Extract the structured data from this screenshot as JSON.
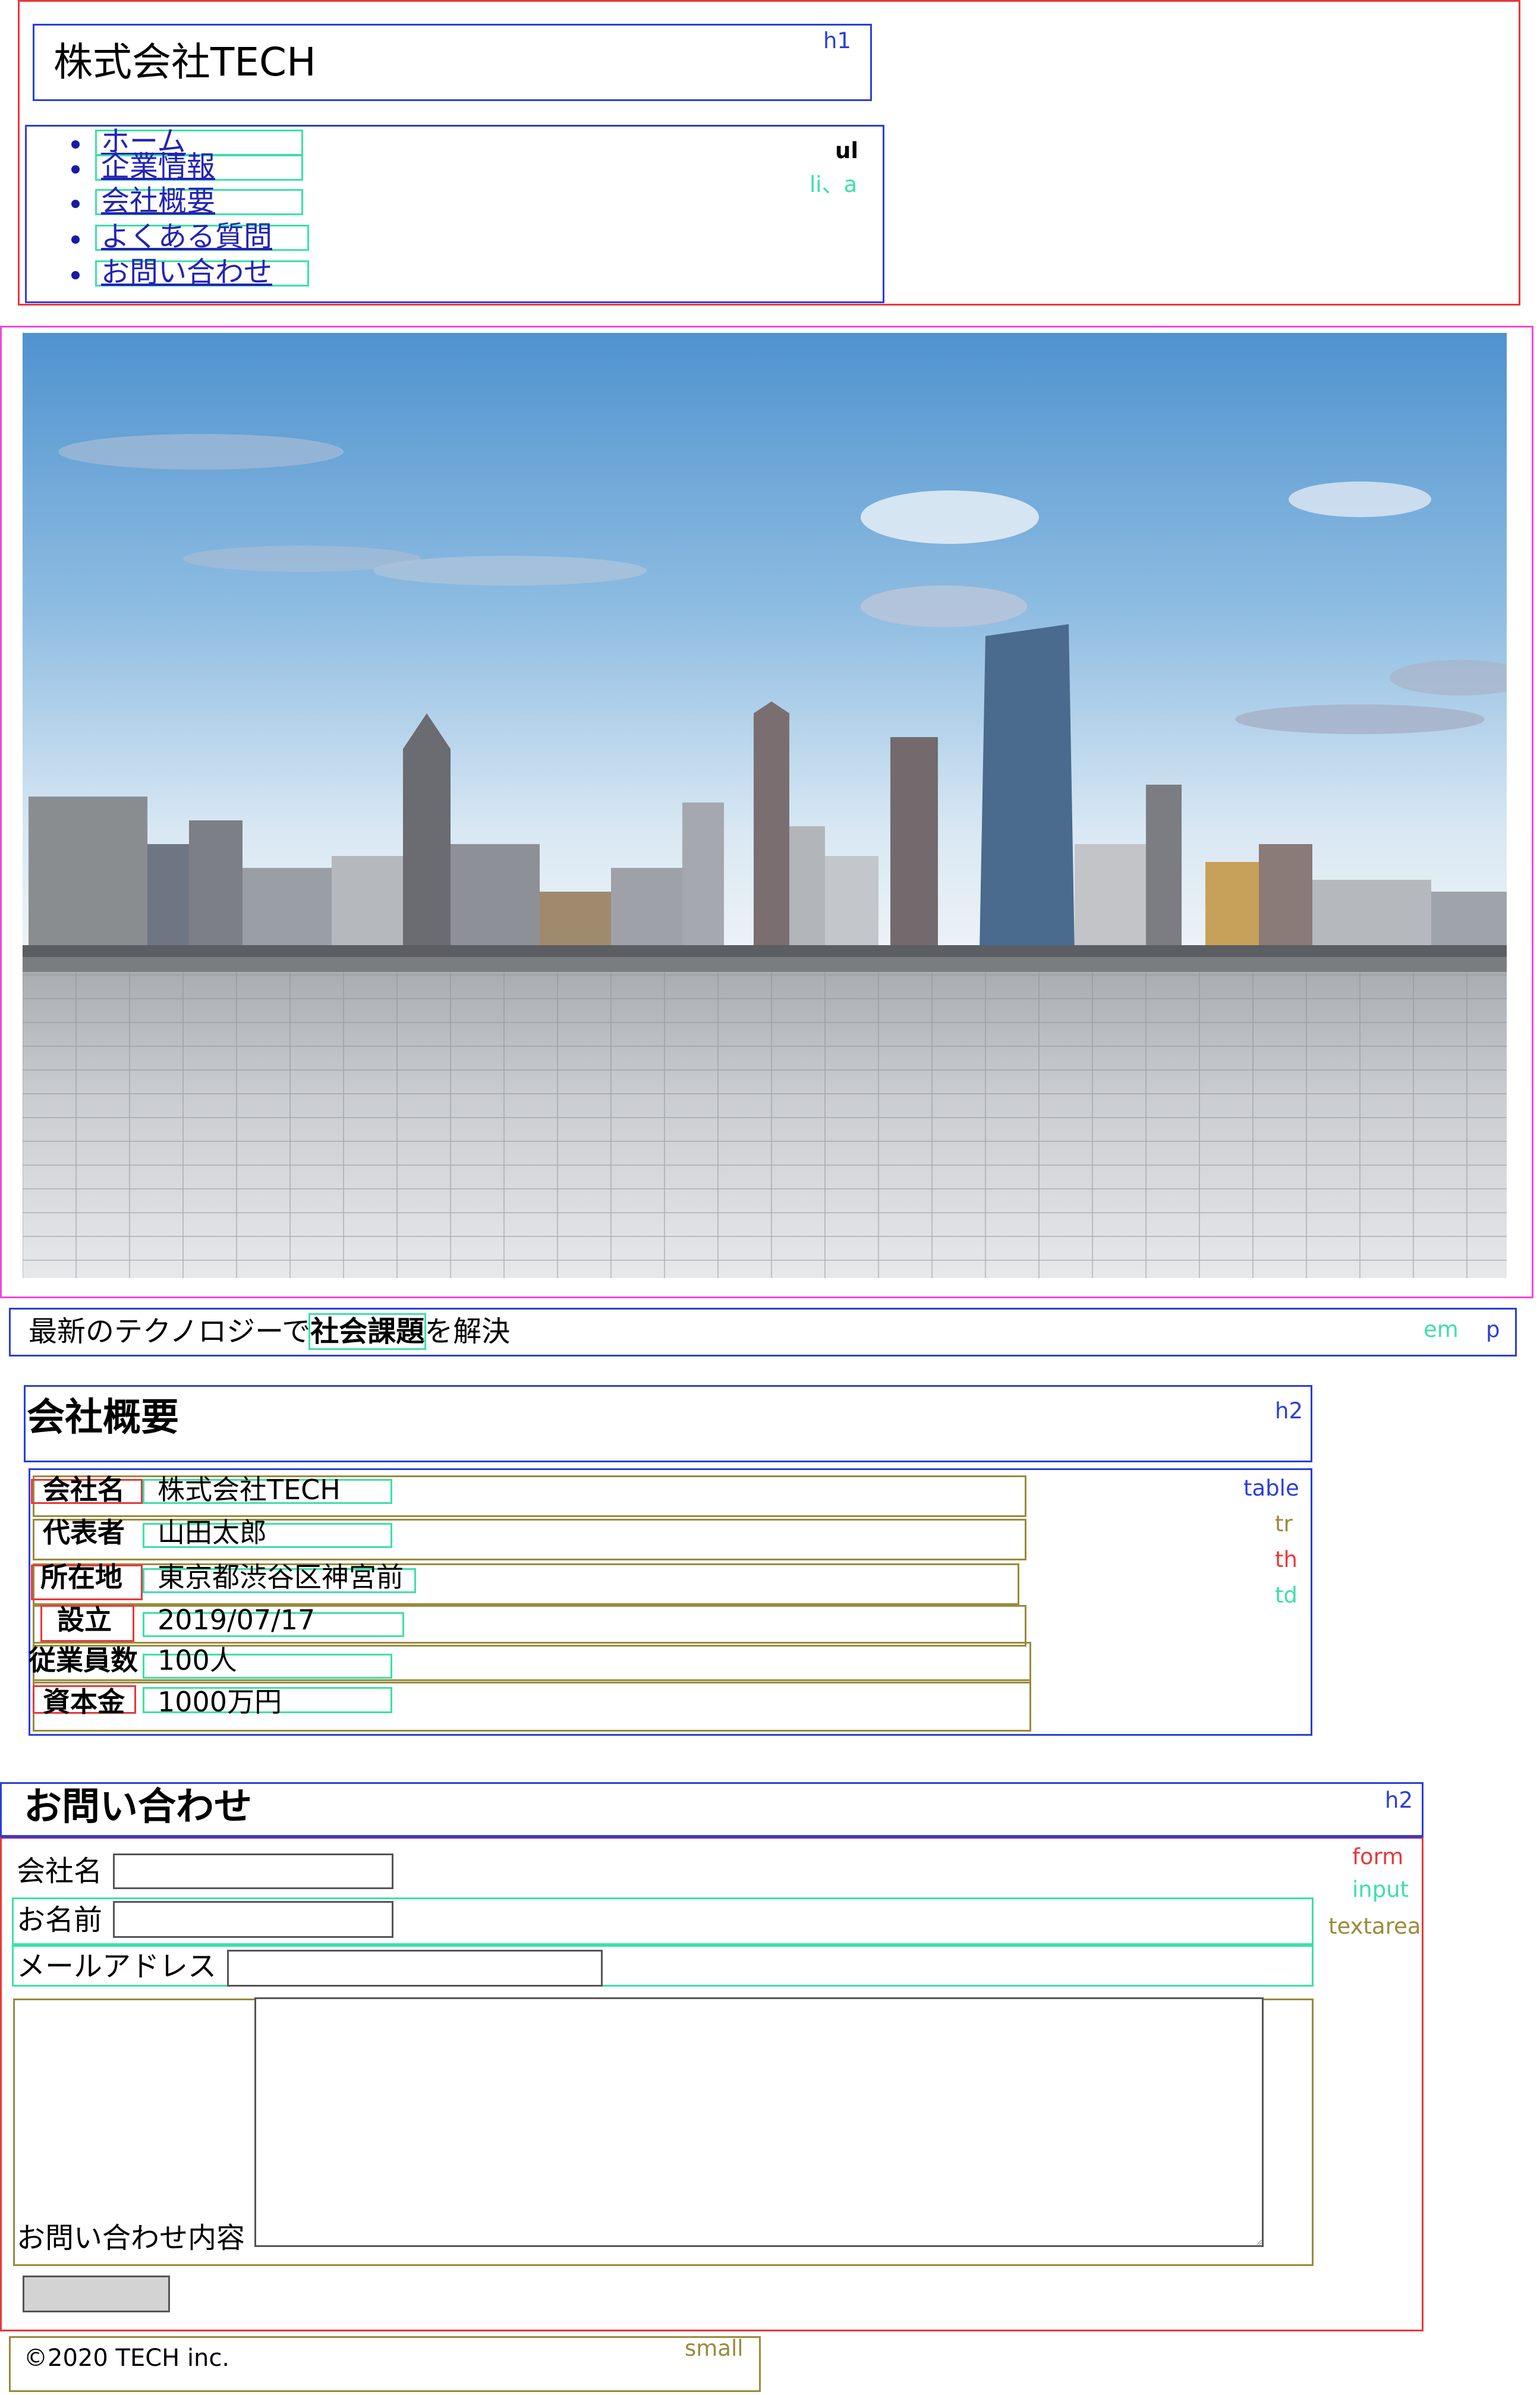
{
  "header": {
    "site_title": "株式会社TECH",
    "nav_items": [
      "ホーム",
      "企業情報",
      "会社概要",
      "よくある質問",
      "お問い合わせ"
    ]
  },
  "annotation_tags": {
    "h1": "h1",
    "ul": "ul",
    "li_a": "li、a",
    "em": "em",
    "p": "p",
    "h2": "h2",
    "table": "table",
    "tr": "tr",
    "th": "th",
    "td": "td",
    "form": "form",
    "input": "input",
    "textarea": "textarea",
    "small": "small"
  },
  "tagline": {
    "before": "最新のテクノロジーで",
    "emphasis": "社会課題",
    "after": "を解決"
  },
  "about": {
    "title": "会社概要",
    "rows": [
      {
        "label": "会社名",
        "value": "株式会社TECH"
      },
      {
        "label": "代表者",
        "value": "山田太郎"
      },
      {
        "label": "所在地",
        "value": "東京都渋谷区神宮前"
      },
      {
        "label": "設立",
        "value": "2019/07/17"
      },
      {
        "label": "従業員数",
        "value": "100人"
      },
      {
        "label": "資本金",
        "value": "1000万円"
      }
    ]
  },
  "contact": {
    "title": "お問い合わせ",
    "company_label": "会社名",
    "name_label": "お名前",
    "email_label": "メールアドレス",
    "message_label": "お問い合わせ内容",
    "company_value": "",
    "name_value": "",
    "email_value": "",
    "message_value": ""
  },
  "footer": {
    "copyright": "©2020 TECH inc."
  },
  "colors": {
    "tag_blue": "#2b3fd6",
    "tag_red": "#e8383d",
    "tag_green": "#3de0a8",
    "tag_olive": "#9a8a3c",
    "tag_magenta": "#f04ad8",
    "link": "#2323b4"
  }
}
